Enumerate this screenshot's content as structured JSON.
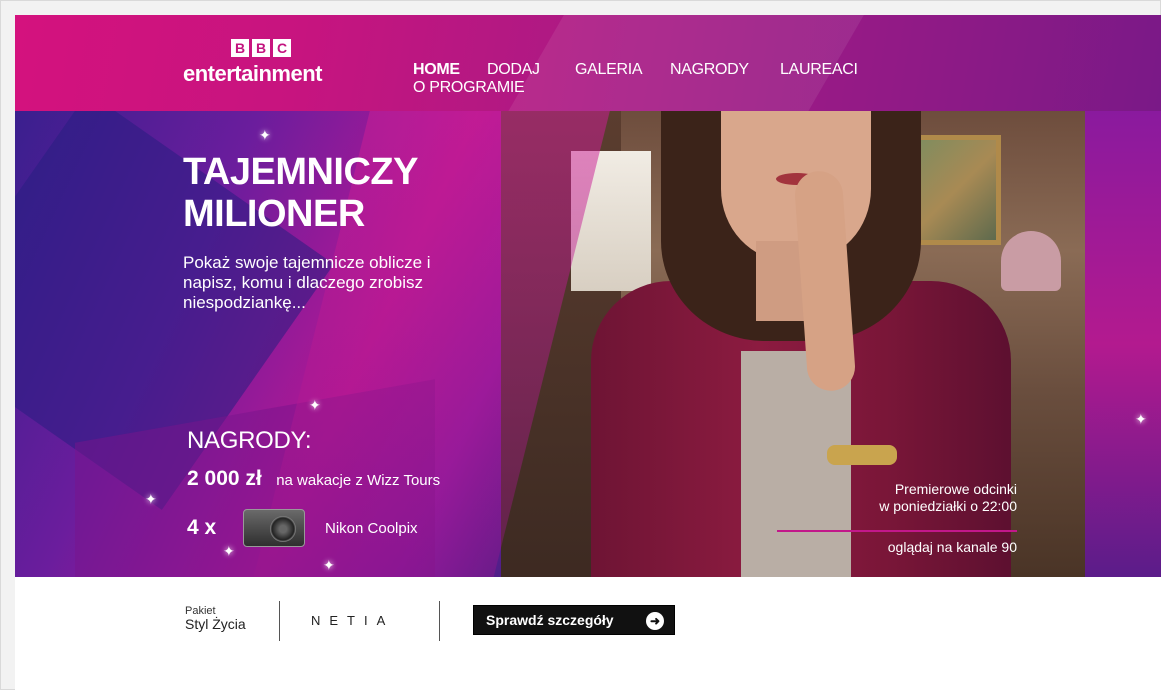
{
  "header": {
    "logo": {
      "bbc": [
        "B",
        "B",
        "C"
      ],
      "text": "entertainment"
    },
    "nav": [
      {
        "label": "HOME",
        "active": true
      },
      {
        "label": "DODAJ",
        "active": false
      },
      {
        "label": "GALERIA",
        "active": false
      },
      {
        "label": "NAGRODY",
        "active": false
      },
      {
        "label": "LAUREACI",
        "active": false
      },
      {
        "label": "O PROGRAMIE",
        "active": false
      }
    ]
  },
  "hero": {
    "title_line1": "TAJEMNICZY",
    "title_line2": "MILIONER",
    "subtitle": "Pokaż swoje tajemnicze oblicze i napisz, komu i dlaczego zrobisz niespodziankę...",
    "prizes_heading": "NAGRODY:",
    "prize1_amount": "2 000 zł",
    "prize1_desc": "na wakacje z Wizz Tours",
    "prize2_count": "4 x",
    "prize2_desc": "Nikon Coolpix",
    "premiere_line1": "Premierowe odcinki",
    "premiere_line2": "w poniedziałki o 22:00",
    "channel": "oglądaj na kanale 90"
  },
  "footer": {
    "pakiet_line1": "Pakiet",
    "pakiet_line2": "Styl Życia",
    "brand": "NETIA",
    "cta_label": "Sprawdź szczegóły"
  },
  "colors": {
    "accent": "#c3147f",
    "header_gradient_start": "#d4127e",
    "header_gradient_end": "#7a1987",
    "cta_bg": "#111111"
  }
}
